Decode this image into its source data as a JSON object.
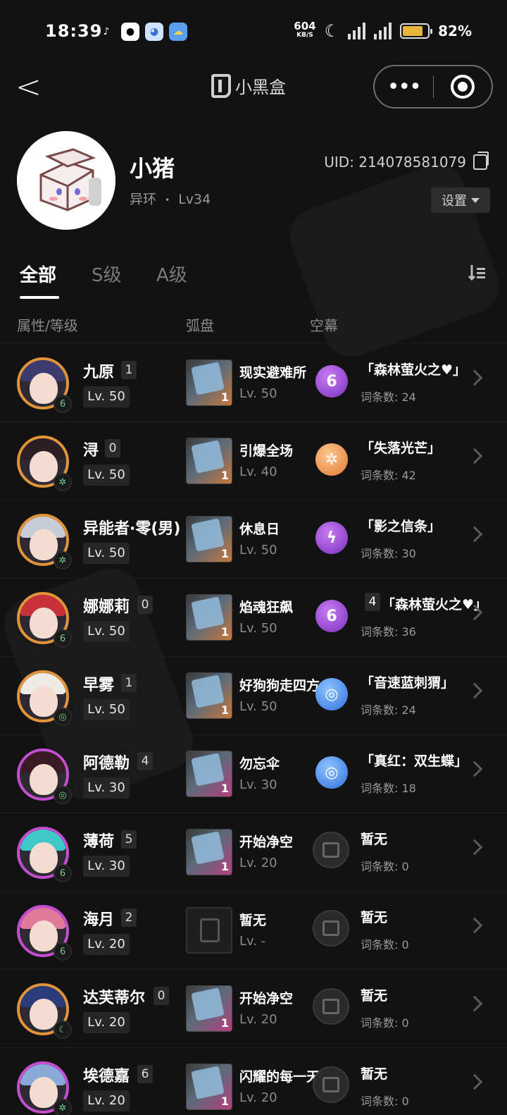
{
  "status_bar": {
    "time": "18:39",
    "net_speed": "604",
    "net_unit": "KB/S",
    "battery": "82%"
  },
  "title_bar": {
    "back": "<",
    "app_name": "小黑盒",
    "more": "•••"
  },
  "profile": {
    "name": "小猪",
    "game": "异环",
    "separator": "•",
    "level": "Lv34",
    "uid": "UID: 214078581079",
    "settings": "设置"
  },
  "tabs": [
    "全部",
    "S级",
    "A级"
  ],
  "columns": [
    "属性/等级",
    "弧盘",
    "空幕"
  ],
  "characters": [
    {
      "name": "九原",
      "rank": "1",
      "level": "Lv. 50",
      "rarity": "orange",
      "hair": "#3c3a6e",
      "attr": "6",
      "disc": {
        "name": "现实避难所",
        "level": "Lv. 50",
        "num": "1",
        "tone": "orange"
      },
      "sky": {
        "name": "「森林萤火之♥」",
        "entries": "词条数: 24",
        "icon": "purple",
        "glyph": "6",
        "count": ""
      }
    },
    {
      "name": "浔",
      "rank": "0",
      "level": "Lv. 50",
      "rarity": "orange",
      "hair": "#2a2024",
      "attr": "✲",
      "disc": {
        "name": "引爆全场",
        "level": "Lv. 40",
        "num": "1",
        "tone": "orange"
      },
      "sky": {
        "name": "「失落光芒」",
        "entries": "词条数: 42",
        "icon": "orange",
        "glyph": "✲",
        "count": ""
      }
    },
    {
      "name": "异能者·零(男)",
      "rank": "",
      "level": "Lv. 50",
      "rarity": "orange",
      "hair": "#c8ccd6",
      "attr": "✲",
      "disc": {
        "name": "休息日",
        "level": "Lv. 50",
        "num": "1",
        "tone": "orange"
      },
      "sky": {
        "name": "「影之信条」",
        "entries": "词条数: 30",
        "icon": "purple",
        "glyph": "ϟ",
        "count": ""
      }
    },
    {
      "name": "娜娜莉",
      "rank": "0",
      "level": "Lv. 50",
      "rarity": "orange",
      "hair": "#c8303a",
      "attr": "6",
      "disc": {
        "name": "焰魂狂飙",
        "level": "Lv. 50",
        "num": "1",
        "tone": "orange"
      },
      "sky": {
        "name": "「森林萤火之♥」",
        "entries": "词条数: 36",
        "icon": "purple",
        "glyph": "6",
        "count": "4"
      }
    },
    {
      "name": "早雾",
      "rank": "1",
      "level": "Lv. 50",
      "rarity": "orange",
      "hair": "#eeeae6",
      "attr": "◎",
      "disc": {
        "name": "好狗狗走四方",
        "level": "Lv. 50",
        "num": "1",
        "tone": "orange"
      },
      "sky": {
        "name": "「音速蓝刺猬」",
        "entries": "词条数: 24",
        "icon": "blue",
        "glyph": "◎",
        "count": ""
      }
    },
    {
      "name": "阿德勒",
      "rank": "4",
      "level": "Lv. 30",
      "rarity": "purple",
      "hair": "#3a1a24",
      "attr": "◎",
      "disc": {
        "name": "勿忘伞",
        "level": "Lv. 30",
        "num": "1",
        "tone": "pink"
      },
      "sky": {
        "name": "「真红：双生蝶」",
        "entries": "词条数: 18",
        "icon": "blue",
        "glyph": "◎",
        "count": ""
      }
    },
    {
      "name": "薄荷",
      "rank": "5",
      "level": "Lv. 30",
      "rarity": "purple",
      "hair": "#3ec8c8",
      "attr": "6",
      "disc": {
        "name": "开始净空",
        "level": "Lv. 20",
        "num": "1",
        "tone": "pink"
      },
      "sky": {
        "name": "暂无",
        "entries": "词条数: 0",
        "icon": "empty",
        "glyph": "",
        "count": ""
      }
    },
    {
      "name": "海月",
      "rank": "2",
      "level": "Lv. 20",
      "rarity": "purple",
      "hair": "#e07a9a",
      "attr": "6",
      "disc": {
        "name": "暂无",
        "level": "Lv. -",
        "num": "",
        "tone": "empty"
      },
      "sky": {
        "name": "暂无",
        "entries": "词条数: 0",
        "icon": "empty",
        "glyph": "",
        "count": ""
      }
    },
    {
      "name": "达芙蒂尔",
      "rank": "0",
      "level": "Lv. 20",
      "rarity": "orange",
      "hair": "#2a3c7a",
      "attr": "☾",
      "disc": {
        "name": "开始净空",
        "level": "Lv. 20",
        "num": "1",
        "tone": "pink"
      },
      "sky": {
        "name": "暂无",
        "entries": "词条数: 0",
        "icon": "empty",
        "glyph": "",
        "count": ""
      }
    },
    {
      "name": "埃德嘉",
      "rank": "6",
      "level": "Lv. 20",
      "rarity": "purple",
      "hair": "#8aa8d8",
      "attr": "✲",
      "disc": {
        "name": "闪耀的每一天",
        "level": "Lv. 20",
        "num": "1",
        "tone": "pink"
      },
      "sky": {
        "name": "暂无",
        "entries": "词条数: 0",
        "icon": "empty",
        "glyph": "",
        "count": ""
      }
    }
  ]
}
